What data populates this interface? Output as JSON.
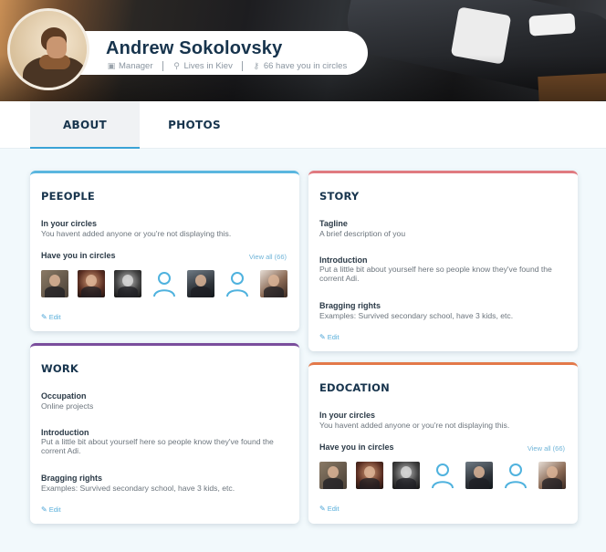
{
  "header": {
    "name": "Andrew Sokolovsky",
    "role": "Manager",
    "location": "Lives in Kiev",
    "circles_count": "66 have you in circles"
  },
  "tabs": [
    {
      "label": "ABOUT",
      "active": true
    },
    {
      "label": "PHOTOS",
      "active": false
    }
  ],
  "people": {
    "title": "PEEOPLE",
    "in_circles_label": "In your circles",
    "in_circles_value": "You havent added anyone or you're not displaying this.",
    "have_you_label": "Have you in circles",
    "view_all": "View all (66)",
    "edit": "Edit",
    "avatars": [
      "photo",
      "photo",
      "photo",
      "placeholder",
      "photo",
      "placeholder",
      "photo"
    ],
    "accent": "#5ab6df"
  },
  "work": {
    "title": "WORK",
    "occupation_label": "Occupation",
    "occupation_value": "Online projects",
    "intro_label": "Introduction",
    "intro_value": "Put a little bit about yourself here so people know they've found the corrent Adi.",
    "bragging_label": "Bragging rights",
    "bragging_value": "Examples: Survived secondary school, have 3 kids, etc.",
    "edit": "Edit",
    "accent": "#7a4d9c"
  },
  "story": {
    "title": "STORY",
    "tagline_label": "Tagline",
    "tagline_value": "A brief description of you",
    "intro_label": "Introduction",
    "intro_value": "Put a little bit about yourself here so people know they've found the corrent Adi.",
    "bragging_label": "Bragging rights",
    "bragging_value": "Examples: Survived secondary school, have 3 kids, etc.",
    "edit": "Edit",
    "accent": "#e07a80"
  },
  "education": {
    "title": "EDOCATION",
    "in_circles_label": "In your circles",
    "in_circles_value": "You havent added anyone or you're not displaying this.",
    "have_you_label": "Have you in circles",
    "view_all": "View all (66)",
    "edit": "Edit",
    "accent": "#e3794a"
  }
}
